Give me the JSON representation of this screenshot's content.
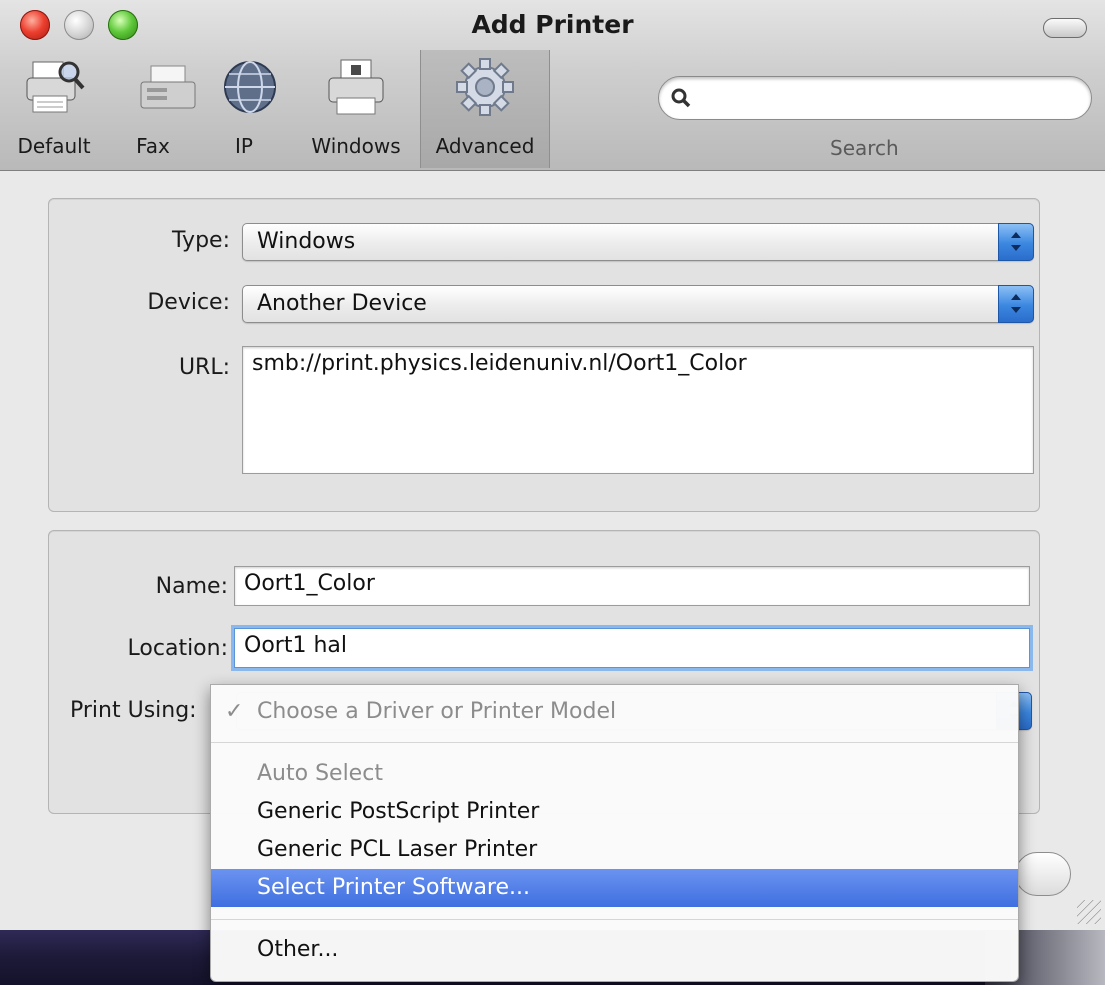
{
  "window": {
    "title": "Add Printer"
  },
  "toolbar": {
    "items": [
      {
        "label": "Default",
        "icon": "default-printer-icon"
      },
      {
        "label": "Fax",
        "icon": "fax-icon"
      },
      {
        "label": "IP",
        "icon": "globe-icon"
      },
      {
        "label": "Windows",
        "icon": "windows-printer-icon"
      },
      {
        "label": "Advanced",
        "icon": "gear-icon",
        "active": true
      }
    ],
    "search": {
      "label": "Search",
      "value": ""
    }
  },
  "connection": {
    "type_label": "Type:",
    "type_value": "Windows",
    "device_label": "Device:",
    "device_value": "Another Device",
    "url_label": "URL:",
    "url_value": "smb://print.physics.leidenuniv.nl/Oort1_Color"
  },
  "details": {
    "name_label": "Name:",
    "name_value": "Oort1_Color",
    "location_label": "Location:",
    "location_value": "Oort1 hal",
    "print_using_label": "Print Using:"
  },
  "print_using_menu": {
    "check": "✓",
    "items": [
      {
        "label": "Choose a Driver or Printer Model",
        "checked": true,
        "disabled": true
      },
      {
        "label": "Auto Select",
        "disabled": true
      },
      {
        "label": "Generic PostScript Printer"
      },
      {
        "label": "Generic PCL Laser Printer"
      },
      {
        "label": "Select Printer Software...",
        "highlighted": true
      },
      {
        "label": "Other..."
      }
    ]
  },
  "colors": {
    "accent": "#3f6fe0",
    "window_bg": "#e9e9e9"
  }
}
